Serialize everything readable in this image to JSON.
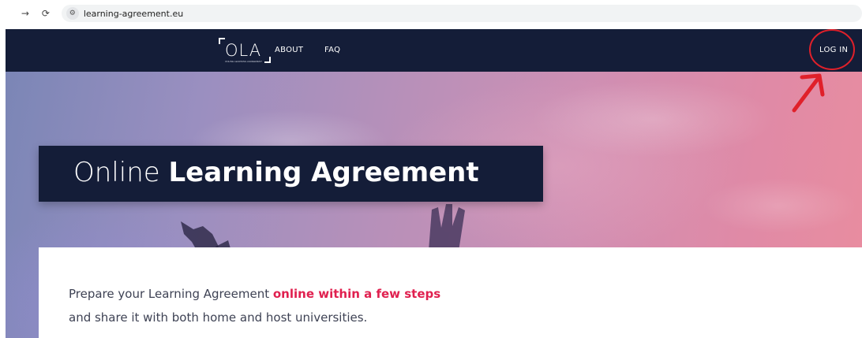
{
  "browser": {
    "back_icon": "arrow-right-icon",
    "forward_icon": "arrow-right-icon",
    "reload_icon": "reload-icon",
    "site_info_icon": "tune-icon",
    "url": "learning-agreement.eu"
  },
  "header": {
    "logo_text": "OLA",
    "logo_tagline": "ONLINE LEARNING AGREEMENT",
    "nav": {
      "about": "ABOUT",
      "faq": "FAQ",
      "login": "LOG IN"
    }
  },
  "hero": {
    "title_light": "Online",
    "title_bold": "Learning Agreement"
  },
  "intro": {
    "line1_prefix": "Prepare your Learning Agreement",
    "line1_highlight": "online within a few steps",
    "line2": "and share it with both home and host universities."
  },
  "annotation": {
    "color": "#e0202a",
    "type": "red circle and arrow pointing to LOG IN"
  },
  "colors": {
    "navy": "#141d38",
    "accent": "#e0204f",
    "body_text": "#3e4254"
  }
}
